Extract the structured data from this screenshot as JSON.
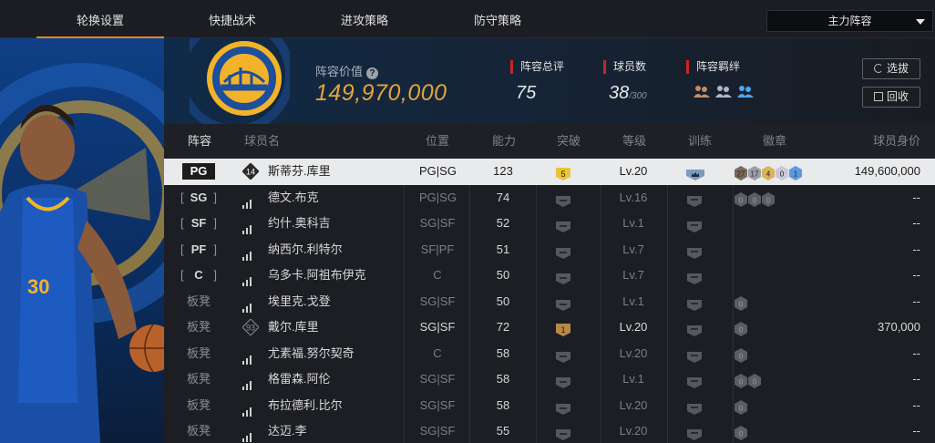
{
  "nav": {
    "tabs": [
      "轮换设置",
      "快捷战术",
      "进攻策略",
      "防守策略"
    ],
    "dropdown_label": "主力阵容"
  },
  "header": {
    "value_label": "阵容价值",
    "value": "149,970,000",
    "rating_label": "阵容总评",
    "rating": "75",
    "count_label": "球员数",
    "count": "38",
    "count_max": "/300",
    "bond_label": "阵容羁绊",
    "buttons": {
      "select": "选拔",
      "recycle": "回收"
    }
  },
  "table": {
    "columns": [
      "阵容",
      "球员名",
      "位置",
      "能力",
      "突破",
      "等级",
      "训练",
      "徽章",
      "球员身价"
    ],
    "rows": [
      {
        "slot": "PG",
        "rank": "14",
        "name": "斯蒂芬.库里",
        "pos": "PG|SG",
        "ability": "123",
        "breakthrough": "5",
        "level": "Lv.20",
        "badges": [
          "27",
          "17",
          "4",
          "0",
          "1"
        ],
        "price": "149,600,000"
      },
      {
        "slot": "SG",
        "name": "德文.布克",
        "pos": "PG|SG",
        "ability": "74",
        "level": "Lv.16",
        "badges": [
          "0",
          "0",
          "0"
        ],
        "price": "--"
      },
      {
        "slot": "SF",
        "name": "约什.奥科吉",
        "pos": "SG|SF",
        "ability": "52",
        "level": "Lv.1",
        "badges": [],
        "price": "--"
      },
      {
        "slot": "PF",
        "name": "纳西尔.利特尔",
        "pos": "SF|PF",
        "ability": "51",
        "level": "Lv.7",
        "badges": [],
        "price": "--"
      },
      {
        "slot": "C",
        "name": "乌多卡.阿祖布伊克",
        "pos": "C",
        "ability": "50",
        "level": "Lv.7",
        "badges": [],
        "price": "--"
      },
      {
        "slot": "板凳",
        "name": "埃里克.戈登",
        "pos": "SG|SF",
        "ability": "50",
        "level": "Lv.1",
        "badges": [
          "0"
        ],
        "price": "--"
      },
      {
        "slot": "板凳",
        "rank": "93",
        "name": "戴尔.库里",
        "pos": "SG|SF",
        "ability": "72",
        "breakthrough": "1",
        "level": "Lv.20",
        "badges": [
          "0"
        ],
        "price": "370,000"
      },
      {
        "slot": "板凳",
        "name": "尤素福.努尔契奇",
        "pos": "C",
        "ability": "58",
        "level": "Lv.20",
        "badges": [
          "0"
        ],
        "price": "--"
      },
      {
        "slot": "板凳",
        "name": "格雷森.阿伦",
        "pos": "SG|SF",
        "ability": "58",
        "level": "Lv.1",
        "badges": [
          "0",
          "0"
        ],
        "price": "--"
      },
      {
        "slot": "板凳",
        "name": "布拉德利.比尔",
        "pos": "SG|SF",
        "ability": "58",
        "level": "Lv.20",
        "badges": [
          "0"
        ],
        "price": "--"
      },
      {
        "slot": "板凳",
        "name": "达迈.李",
        "pos": "SG|SF",
        "ability": "55",
        "level": "Lv.20",
        "badges": [
          "0"
        ],
        "price": "--"
      }
    ]
  },
  "colors": {
    "accent": "#e08a1b",
    "value_gold": "#e2a43b",
    "stat_red": "#c8252b",
    "team_blue": "#1d4f9c",
    "team_gold": "#f2b32a"
  }
}
